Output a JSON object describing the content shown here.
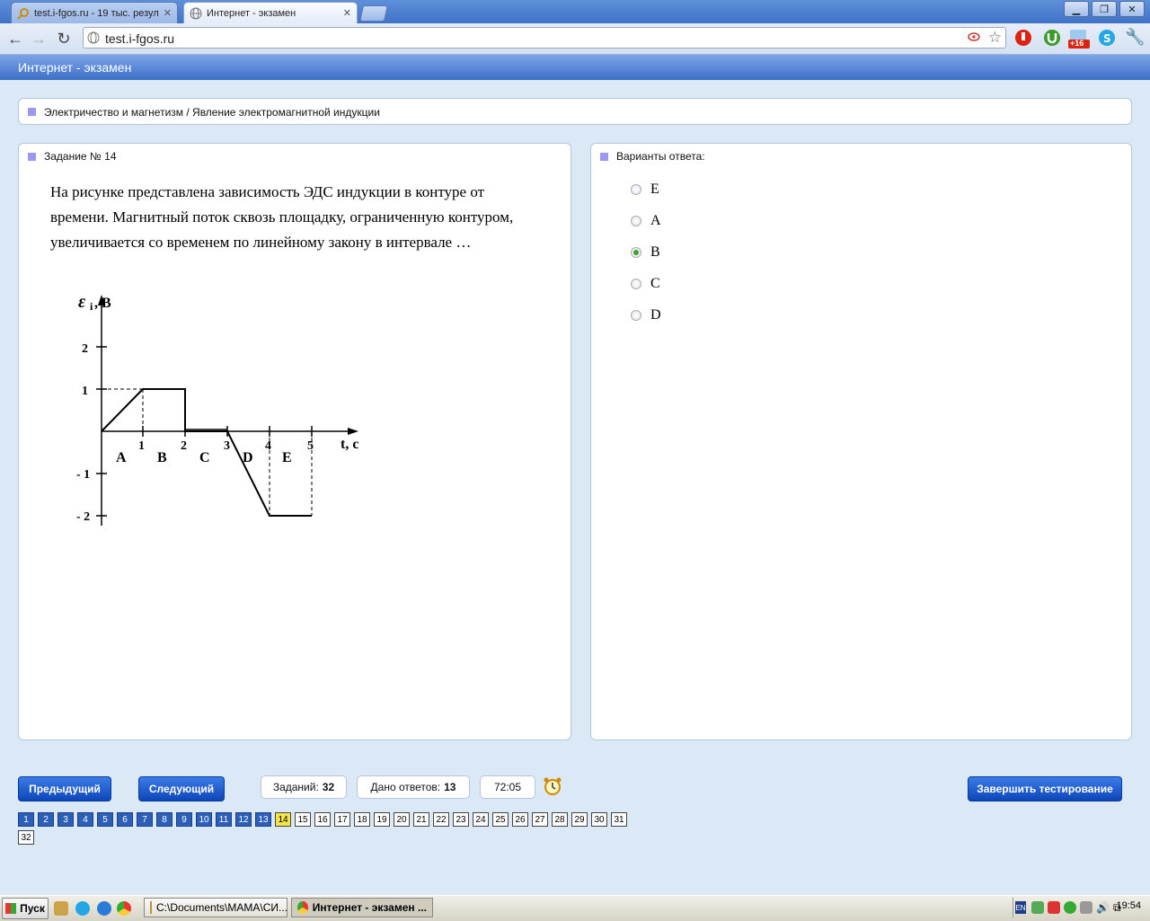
{
  "browser": {
    "tabs": [
      {
        "label": "test.i-fgos.ru - 19 тыс. резул",
        "active": false
      },
      {
        "label": "Интернет - экзамен",
        "active": true
      }
    ],
    "url": "test.i-fgos.ru",
    "badge": "+16"
  },
  "app": {
    "title": "Интернет - экзамен",
    "breadcrumb": "Электричество и магнетизм / Явление электромагнитной индукции"
  },
  "task": {
    "title": "Задание № 14",
    "question": "На рисунке представлена зависимость ЭДС индукции в контуре от времени. Магнитный поток сквозь площадку, ограниченную контуром, увеличивается со временем по линейному закону в интервале …",
    "figure": {
      "ylabel_symbol": "ε",
      "ylabel_sub": "i",
      "ylabel_unit": ", B",
      "xlabel": "t, c",
      "yticks": [
        "2",
        "1",
        "- 1",
        "- 2"
      ],
      "xticks": [
        "1",
        "2",
        "3",
        "4",
        "5"
      ],
      "intervals": [
        "A",
        "B",
        "C",
        "D",
        "E"
      ]
    }
  },
  "answers": {
    "title": "Варианты ответа:",
    "options": [
      {
        "label": "E",
        "selected": false
      },
      {
        "label": "A",
        "selected": false
      },
      {
        "label": "B",
        "selected": true
      },
      {
        "label": "C",
        "selected": false
      },
      {
        "label": "D",
        "selected": false
      }
    ]
  },
  "footer": {
    "prev": "Предыдущий",
    "next": "Следующий",
    "tasks_label": "Заданий:",
    "tasks_count": "32",
    "answered_label": "Дано ответов:",
    "answered_count": "13",
    "timer": "72:05",
    "finish": "Завершить тестирование",
    "current_question": 14,
    "answered_up_to": 13,
    "question_numbers": [
      "1",
      "2",
      "3",
      "4",
      "5",
      "6",
      "7",
      "8",
      "9",
      "10",
      "11",
      "12",
      "13",
      "14",
      "15",
      "16",
      "17",
      "18",
      "19",
      "20",
      "21",
      "22",
      "23",
      "24",
      "25",
      "26",
      "27",
      "28",
      "29",
      "30",
      "31",
      "32"
    ]
  },
  "taskbar": {
    "start": "Пуск",
    "items": [
      {
        "label": "C:\\Documents\\МАМА\\СИ...",
        "active": false
      },
      {
        "label": "Интернет - экзамен ...",
        "active": true
      }
    ],
    "lang": "EN",
    "time": "19:54"
  }
}
